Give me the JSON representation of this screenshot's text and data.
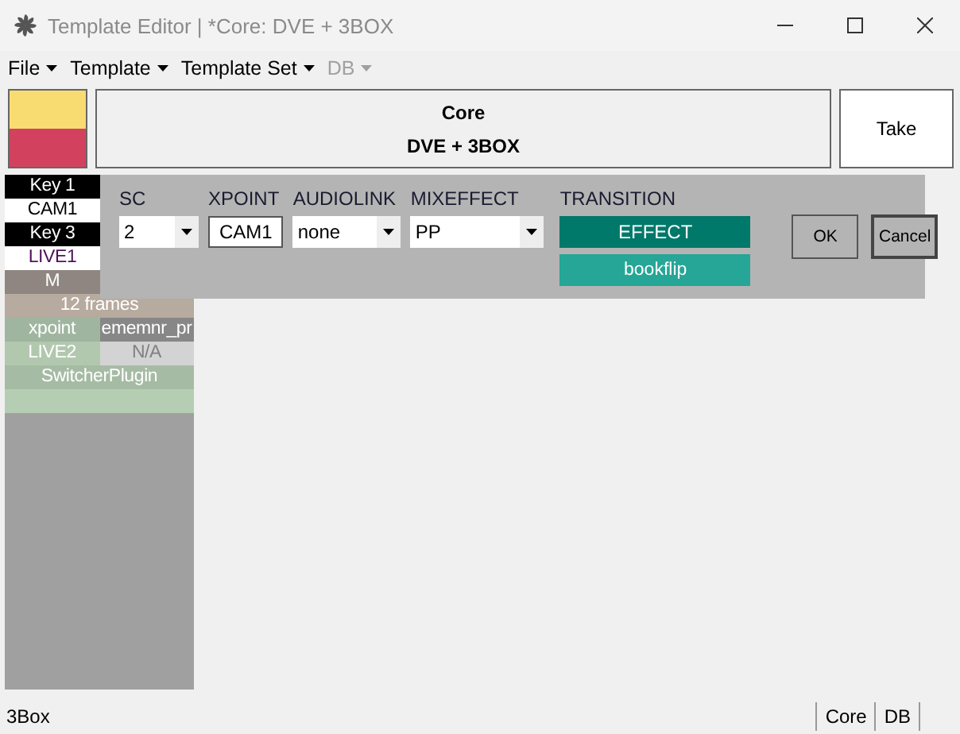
{
  "window": {
    "title": "Template Editor | *Core: DVE + 3BOX"
  },
  "menu": [
    {
      "label": "File",
      "disabled": false
    },
    {
      "label": "Template",
      "disabled": false
    },
    {
      "label": "Template Set",
      "disabled": false
    },
    {
      "label": "DB",
      "disabled": true
    }
  ],
  "swatches": [
    {
      "color": "#f8dc72"
    },
    {
      "color": "#d2425e"
    }
  ],
  "header": {
    "line_1": "Core",
    "line_2": "DVE + 3BOX"
  },
  "take_button": "Take",
  "left_panel": {
    "rows": [
      {
        "cells": [
          {
            "text": "Key 1",
            "kind": "key",
            "color": "#000000"
          }
        ]
      },
      {
        "cells": [
          {
            "text": "CAM1",
            "kind": "source",
            "color": "#ffffff"
          }
        ]
      },
      {
        "cells": [
          {
            "text": "Key 3",
            "kind": "key",
            "color": "#000000"
          }
        ]
      },
      {
        "cells": [
          {
            "text": "LIVE1",
            "kind": "live",
            "color": "#ffffff"
          }
        ]
      },
      {
        "cells": [
          {
            "text": "M",
            "kind": "info",
            "color": "#8f8681"
          }
        ]
      },
      {
        "cells": [
          {
            "text": "12 frames",
            "kind": "info",
            "color": "#b7aa9e"
          }
        ]
      },
      {
        "cells": [
          {
            "text": "xpoint",
            "kind": "info",
            "color": "#9fb59f"
          },
          {
            "text": "ememnr_pr",
            "kind": "info",
            "color": "#878787"
          }
        ]
      },
      {
        "cells": [
          {
            "text": "LIVE2",
            "kind": "info",
            "color": "#b1c8ae"
          },
          {
            "text": "N/A",
            "kind": "muted",
            "color": "#d3d3d3"
          }
        ]
      },
      {
        "cells": [
          {
            "text": "SwitcherPlugin",
            "kind": "info",
            "color": "#a6bba4"
          }
        ]
      },
      {
        "cells": [
          {
            "kind": "info",
            "color": "#b5ceb3"
          }
        ]
      }
    ]
  },
  "popup": {
    "fields": [
      {
        "label": "SC",
        "kind": "dropdown",
        "value": "2"
      },
      {
        "label": "XPOINT",
        "kind": "text",
        "value": "CAM1"
      },
      {
        "label": "AUDIOLINK",
        "kind": "dropdown",
        "value": "none"
      },
      {
        "label": "MIXEFFECT",
        "kind": "dropdown",
        "value": "PP"
      }
    ],
    "transition": {
      "label": "TRANSITION",
      "effect": "EFFECT",
      "value": "bookflip"
    },
    "buttons": [
      {
        "label": "OK",
        "default": false
      },
      {
        "label": "Cancel",
        "default": true
      }
    ]
  },
  "status_bar": {
    "left": "3Box",
    "right": [
      "Core",
      "DB"
    ]
  }
}
